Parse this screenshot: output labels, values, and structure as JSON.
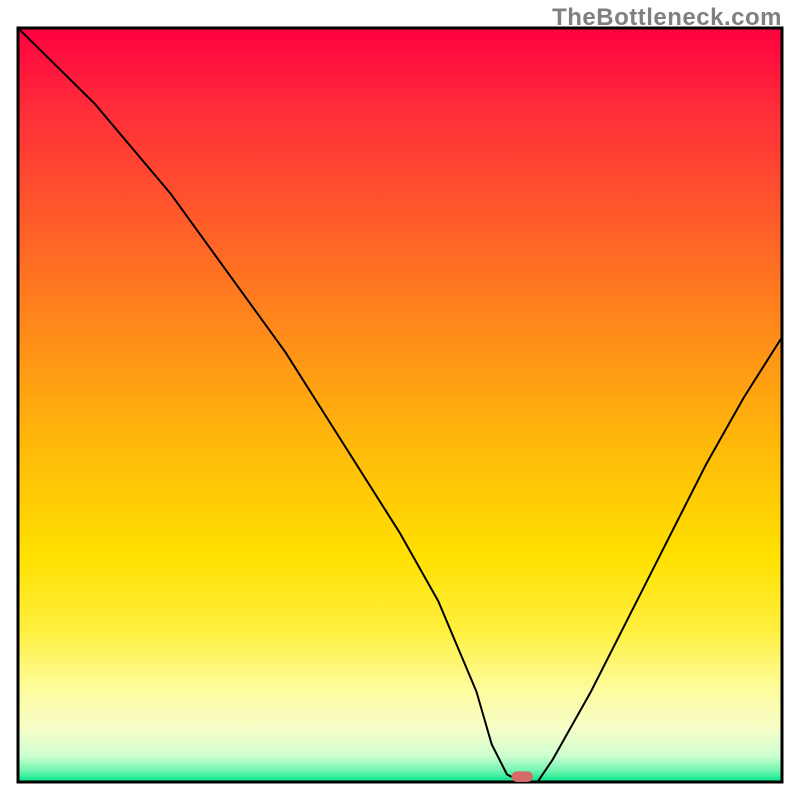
{
  "watermark": "TheBottleneck.com",
  "chart_data": {
    "type": "line",
    "title": "",
    "xlabel": "",
    "ylabel": "",
    "xlim": [
      0,
      100
    ],
    "ylim": [
      0,
      100
    ],
    "x": [
      0,
      5,
      10,
      15,
      20,
      25,
      30,
      35,
      40,
      45,
      50,
      55,
      60,
      62,
      64,
      66,
      68,
      70,
      75,
      80,
      85,
      90,
      95,
      100
    ],
    "values": [
      100,
      95,
      90,
      84,
      78,
      71,
      64,
      57,
      49,
      41,
      33,
      24,
      12,
      5,
      1,
      0,
      0,
      3,
      12,
      22,
      32,
      42,
      51,
      59
    ],
    "marker": {
      "x": 66,
      "y": 0.7,
      "width": 2.8,
      "height": 1.4,
      "color": "#d46a6a"
    },
    "gradient_stops": [
      {
        "offset": 0.0,
        "color": "#ff0040"
      },
      {
        "offset": 0.1,
        "color": "#ff2a3a"
      },
      {
        "offset": 0.25,
        "color": "#ff5a2a"
      },
      {
        "offset": 0.4,
        "color": "#ff8a1a"
      },
      {
        "offset": 0.55,
        "color": "#ffb80a"
      },
      {
        "offset": 0.7,
        "color": "#ffe000"
      },
      {
        "offset": 0.8,
        "color": "#fff040"
      },
      {
        "offset": 0.88,
        "color": "#fdfca0"
      },
      {
        "offset": 0.93,
        "color": "#f6fdc8"
      },
      {
        "offset": 0.965,
        "color": "#cfffd0"
      },
      {
        "offset": 0.985,
        "color": "#70f5b0"
      },
      {
        "offset": 1.0,
        "color": "#00e48a"
      }
    ],
    "frame_color": "#000000",
    "line_color": "#000000",
    "line_width": 2
  }
}
